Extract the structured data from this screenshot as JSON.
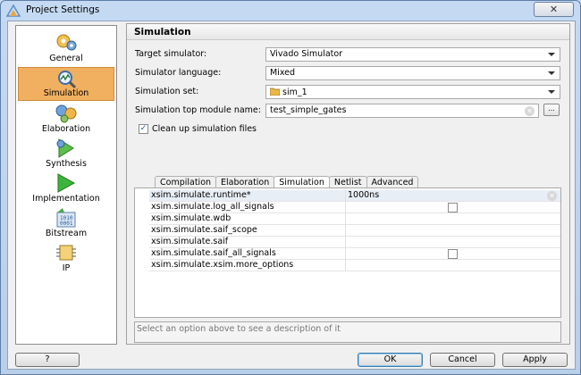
{
  "window": {
    "title": "Project Settings",
    "close_label": "✕"
  },
  "sidebar": {
    "items": [
      {
        "label": "General",
        "icon": "general-icon",
        "selected": false
      },
      {
        "label": "Simulation",
        "icon": "simulation-icon",
        "selected": true
      },
      {
        "label": "Elaboration",
        "icon": "elaboration-icon",
        "selected": false
      },
      {
        "label": "Synthesis",
        "icon": "synthesis-icon",
        "selected": false
      },
      {
        "label": "Implementation",
        "icon": "implementation-icon",
        "selected": false
      },
      {
        "label": "Bitstream",
        "icon": "bitstream-icon",
        "selected": false
      },
      {
        "label": "IP",
        "icon": "ip-icon",
        "selected": false
      }
    ]
  },
  "main": {
    "header": "Simulation",
    "target_simulator": {
      "label": "Target simulator:",
      "value": "Vivado Simulator"
    },
    "simulator_language": {
      "label": "Simulator language:",
      "value": "Mixed"
    },
    "simulation_set": {
      "label": "Simulation set:",
      "value": "sim_1"
    },
    "top_module": {
      "label": "Simulation top module name:",
      "value": "test_simple_gates"
    },
    "browse_label": "...",
    "clean_up": {
      "label": "Clean up simulation files",
      "checked": true,
      "check_mark": "✓"
    },
    "tabs": [
      {
        "label": "Compilation",
        "active": false
      },
      {
        "label": "Elaboration",
        "active": false
      },
      {
        "label": "Simulation",
        "active": true
      },
      {
        "label": "Netlist",
        "active": false
      },
      {
        "label": "Advanced",
        "active": false
      }
    ],
    "properties": [
      {
        "name": "xsim.simulate.runtime*",
        "value": "1000ns",
        "type": "text"
      },
      {
        "name": "xsim.simulate.log_all_signals",
        "value": "",
        "type": "checkbox"
      },
      {
        "name": "xsim.simulate.wdb",
        "value": "",
        "type": "text"
      },
      {
        "name": "xsim.simulate.saif_scope",
        "value": "",
        "type": "text"
      },
      {
        "name": "xsim.simulate.saif",
        "value": "",
        "type": "text"
      },
      {
        "name": "xsim.simulate.saif_all_signals",
        "value": "",
        "type": "checkbox"
      },
      {
        "name": "xsim.simulate.xsim.more_options",
        "value": "",
        "type": "text"
      }
    ],
    "description": "Select an option above to see a description of it"
  },
  "buttons": {
    "help": "?",
    "ok": "OK",
    "cancel": "Cancel",
    "apply": "Apply"
  },
  "colors": {
    "selected_item": "#f0b060",
    "title_bar": "#c5daf2",
    "default_button_border": "#3c7fb1"
  }
}
